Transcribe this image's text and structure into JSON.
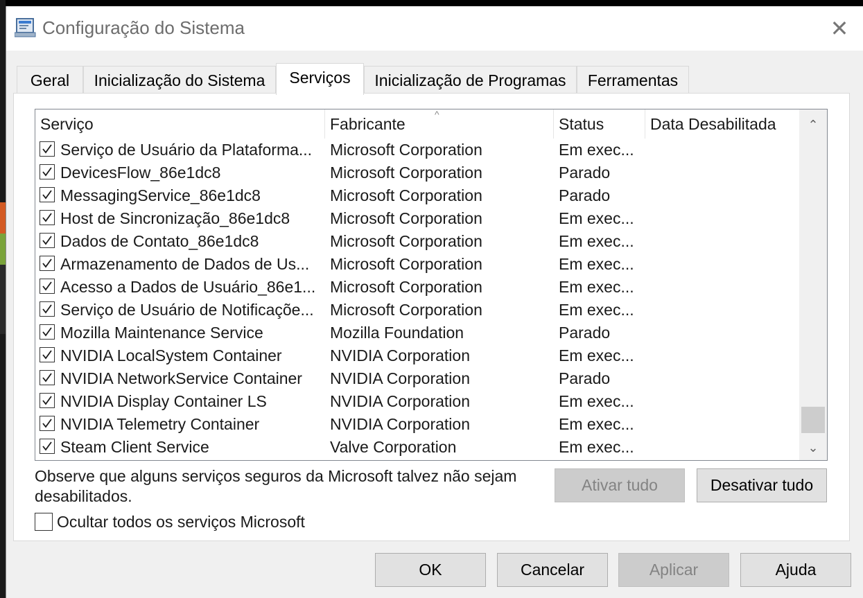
{
  "window": {
    "title": "Configuração do Sistema",
    "close_glyph": "✕"
  },
  "tabs": [
    {
      "label": "Geral"
    },
    {
      "label": "Inicialização do Sistema"
    },
    {
      "label": "Serviços",
      "active": true
    },
    {
      "label": "Inicialização de Programas"
    },
    {
      "label": "Ferramentas"
    }
  ],
  "services": {
    "columns": [
      "Serviço",
      "Fabricante",
      "Status",
      "Data Desabilitada"
    ],
    "sort_indicator": "^",
    "rows": [
      {
        "checked": true,
        "name": "Serviço de Usuário da Plataforma...",
        "maker": "Microsoft Corporation",
        "status": "Em exec...",
        "disabled_date": ""
      },
      {
        "checked": true,
        "name": "DevicesFlow_86e1dc8",
        "maker": "Microsoft Corporation",
        "status": "Parado",
        "disabled_date": ""
      },
      {
        "checked": true,
        "name": "MessagingService_86e1dc8",
        "maker": "Microsoft Corporation",
        "status": "Parado",
        "disabled_date": ""
      },
      {
        "checked": true,
        "name": "Host de Sincronização_86e1dc8",
        "maker": "Microsoft Corporation",
        "status": "Em exec...",
        "disabled_date": ""
      },
      {
        "checked": true,
        "name": "Dados de Contato_86e1dc8",
        "maker": "Microsoft Corporation",
        "status": "Em exec...",
        "disabled_date": ""
      },
      {
        "checked": true,
        "name": "Armazenamento de Dados de Us...",
        "maker": "Microsoft Corporation",
        "status": "Em exec...",
        "disabled_date": ""
      },
      {
        "checked": true,
        "name": "Acesso a Dados de Usuário_86e1...",
        "maker": "Microsoft Corporation",
        "status": "Em exec...",
        "disabled_date": ""
      },
      {
        "checked": true,
        "name": "Serviço de Usuário de Notificaçõe...",
        "maker": "Microsoft Corporation",
        "status": "Em exec...",
        "disabled_date": ""
      },
      {
        "checked": true,
        "name": "Mozilla Maintenance Service",
        "maker": "Mozilla Foundation",
        "status": "Parado",
        "disabled_date": ""
      },
      {
        "checked": true,
        "name": "NVIDIA LocalSystem Container",
        "maker": "NVIDIA Corporation",
        "status": "Em exec...",
        "disabled_date": ""
      },
      {
        "checked": true,
        "name": "NVIDIA NetworkService Container",
        "maker": "NVIDIA Corporation",
        "status": "Parado",
        "disabled_date": ""
      },
      {
        "checked": true,
        "name": "NVIDIA Display Container LS",
        "maker": "NVIDIA Corporation",
        "status": "Em exec...",
        "disabled_date": ""
      },
      {
        "checked": true,
        "name": "NVIDIA Telemetry Container",
        "maker": "NVIDIA Corporation",
        "status": "Em exec...",
        "disabled_date": ""
      },
      {
        "checked": true,
        "name": "Steam Client Service",
        "maker": "Valve Corporation",
        "status": "Em exec...",
        "disabled_date": ""
      }
    ],
    "scroll_up_glyph": "⌃",
    "scroll_down_glyph": "⌄"
  },
  "note": "Observe que alguns serviços seguros da Microsoft talvez não sejam desabilitados.",
  "buttons": {
    "enable_all": "Ativar tudo",
    "disable_all": "Desativar tudo",
    "ok": "OK",
    "cancel": "Cancelar",
    "apply": "Aplicar",
    "help": "Ajuda"
  },
  "hide_ms": {
    "label": "Ocultar todos os serviços Microsoft",
    "checked": false
  },
  "icons": {
    "app": "system-config-icon",
    "close": "close-icon",
    "check": "checkmark-icon"
  }
}
